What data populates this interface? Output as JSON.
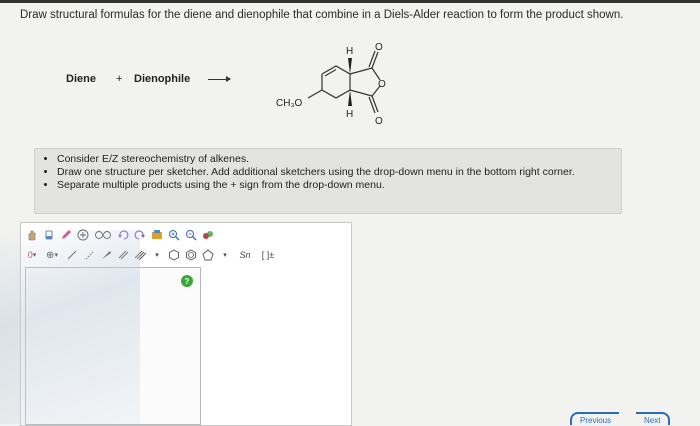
{
  "question": "Draw structural formulas for the diene and dienophile that combine in a Diels-Alder reaction to form the product shown.",
  "reaction": {
    "diene": "Diene",
    "plus": "+",
    "dienophile": "Dienophile",
    "substituent": "CH₃O",
    "h_top": "H",
    "h_bottom": "H",
    "o_top": "O",
    "o_ring": "O",
    "o_bottom": "O"
  },
  "instructions": [
    "Consider E/Z stereochemistry of alkenes.",
    "Draw one structure per sketcher. Add additional sketchers using the drop-down menu in the bottom right corner.",
    "Separate multiple products using the + sign from the drop-down menu."
  ],
  "sketcher": {
    "toolbar1": [
      "hand-icon",
      "eraser-icon",
      "pencil-icon",
      "add-atom-icon",
      "chain-icon",
      "undo-icon",
      "redo-icon",
      "template-icon",
      "zoom-in-icon",
      "zoom-out-icon",
      "atom-color-icon"
    ],
    "toolbar2": {
      "charge": "0",
      "plus_circle": "⊕",
      "templates_label": "Sn",
      "bracket_label": "[ ]±"
    },
    "help": "?"
  },
  "nav": {
    "prev": "Previous",
    "next": "Next"
  },
  "colors": {
    "accent": "#2a6db3",
    "help_green": "#3aa637"
  }
}
